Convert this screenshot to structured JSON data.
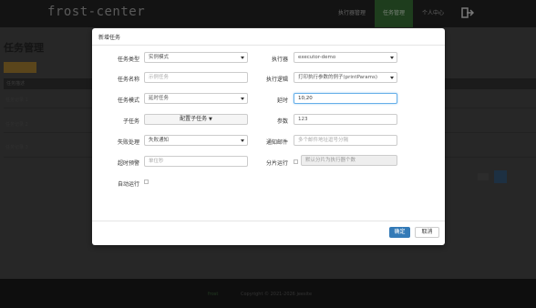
{
  "app": {
    "logo": "frost-center",
    "nav": [
      "执行器管理",
      "任务管理",
      "个人中心"
    ]
  },
  "page": {
    "title": "任务管理",
    "table_header": "任务描述",
    "rows": [
      "任务记录 1",
      "任务记录 2",
      "任务记录 3"
    ]
  },
  "footer": {
    "brand": "frost",
    "copyright": "Copyright © 2021-2026 jeesite"
  },
  "modal": {
    "title": "新增任务",
    "fields": {
      "task_type_label": "任务类型",
      "task_type_value": "实例模式",
      "executor_label": "执行器",
      "executor_value": "executor-demo",
      "task_name_label": "任务名称",
      "task_name_placeholder": "示例任务",
      "exec_logic_label": "执行逻辑",
      "exec_logic_value": "打印执行参数的例子(printParams)",
      "task_mode_label": "任务模式",
      "task_mode_value": "延时任务",
      "delay_label": "延时",
      "delay_value": "10,20",
      "subtask_label": "子任务",
      "subtask_button": "配置子任务",
      "param_label": "参数",
      "param_value": "123",
      "fail_label": "失败处理",
      "fail_value": "失败通知",
      "notify_label": "通知邮件",
      "notify_placeholder": "多个邮件地址逗号分隔",
      "timeout_label": "超时预警",
      "timeout_placeholder": "单位秒",
      "shard_label": "分片运行",
      "shard_placeholder": "默认分片为执行器个数",
      "auto_label": "自动运行"
    },
    "ok": "确定",
    "cancel": "取消"
  }
}
